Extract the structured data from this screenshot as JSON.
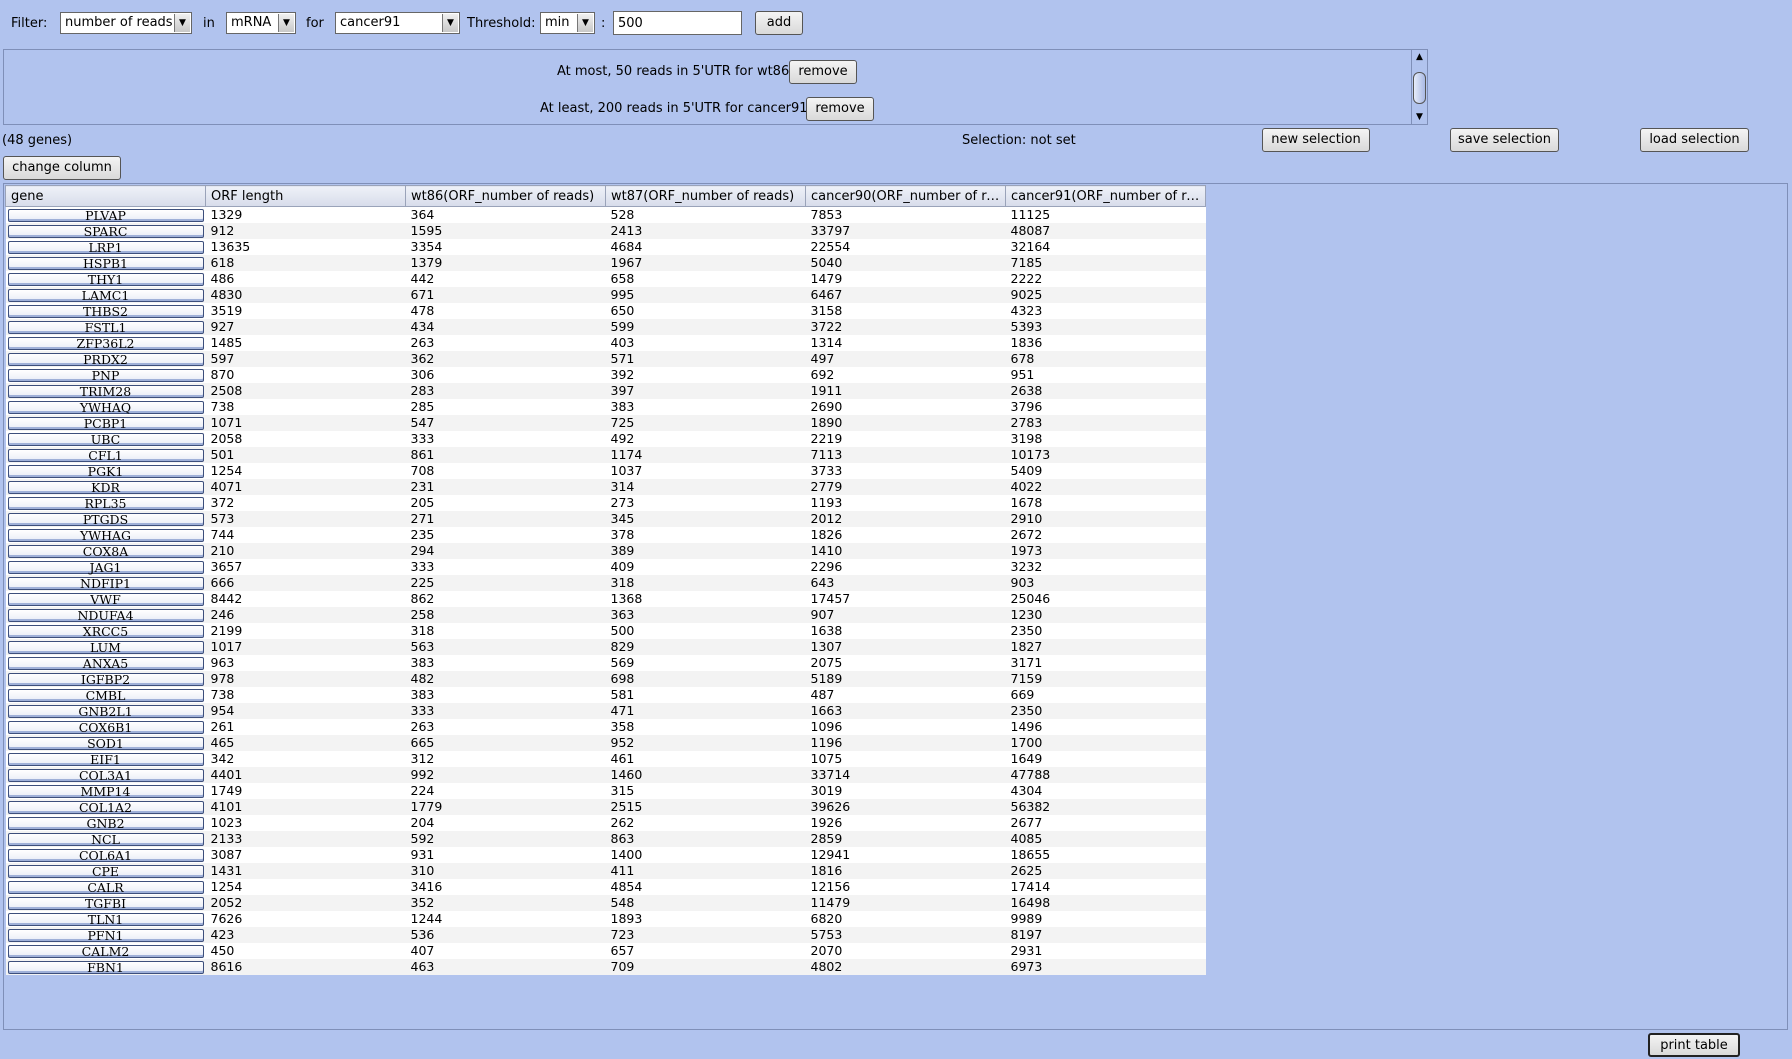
{
  "filter_bar": {
    "filter_label": "Filter:",
    "metric": "number of reads",
    "in_label": "in",
    "region": "mRNA",
    "for_label": "for",
    "sample": "cancer91",
    "threshold_label": "Threshold:",
    "threshold_mode": "min",
    "colon": ":",
    "threshold_value": "500",
    "add_label": "add"
  },
  "active_filters": [
    {
      "text": "At most, 50 reads in 5'UTR for wt86",
      "remove_label": "remove"
    },
    {
      "text": "At least, 200 reads in 5'UTR for cancer91",
      "remove_label": "remove"
    }
  ],
  "status": {
    "gene_count": "(48 genes)",
    "selection": "Selection: not set",
    "new_selection": "new selection",
    "save_selection": "save selection",
    "load_selection": "load selection",
    "change_column": "change column",
    "print_table": "print table"
  },
  "table": {
    "columns": [
      "gene",
      "ORF length",
      "wt86(ORF_number of reads)",
      "wt87(ORF_number of reads)",
      "cancer90(ORF_number of re...",
      "cancer91(ORF_number of re..."
    ],
    "rows": [
      [
        "PLVAP",
        "1329",
        "364",
        "528",
        "7853",
        "11125"
      ],
      [
        "SPARC",
        "912",
        "1595",
        "2413",
        "33797",
        "48087"
      ],
      [
        "LRP1",
        "13635",
        "3354",
        "4684",
        "22554",
        "32164"
      ],
      [
        "HSPB1",
        "618",
        "1379",
        "1967",
        "5040",
        "7185"
      ],
      [
        "THY1",
        "486",
        "442",
        "658",
        "1479",
        "2222"
      ],
      [
        "LAMC1",
        "4830",
        "671",
        "995",
        "6467",
        "9025"
      ],
      [
        "THBS2",
        "3519",
        "478",
        "650",
        "3158",
        "4323"
      ],
      [
        "FSTL1",
        "927",
        "434",
        "599",
        "3722",
        "5393"
      ],
      [
        "ZFP36L2",
        "1485",
        "263",
        "403",
        "1314",
        "1836"
      ],
      [
        "PRDX2",
        "597",
        "362",
        "571",
        "497",
        "678"
      ],
      [
        "PNP",
        "870",
        "306",
        "392",
        "692",
        "951"
      ],
      [
        "TRIM28",
        "2508",
        "283",
        "397",
        "1911",
        "2638"
      ],
      [
        "YWHAQ",
        "738",
        "285",
        "383",
        "2690",
        "3796"
      ],
      [
        "PCBP1",
        "1071",
        "547",
        "725",
        "1890",
        "2783"
      ],
      [
        "UBC",
        "2058",
        "333",
        "492",
        "2219",
        "3198"
      ],
      [
        "CFL1",
        "501",
        "861",
        "1174",
        "7113",
        "10173"
      ],
      [
        "PGK1",
        "1254",
        "708",
        "1037",
        "3733",
        "5409"
      ],
      [
        "KDR",
        "4071",
        "231",
        "314",
        "2779",
        "4022"
      ],
      [
        "RPL35",
        "372",
        "205",
        "273",
        "1193",
        "1678"
      ],
      [
        "PTGDS",
        "573",
        "271",
        "345",
        "2012",
        "2910"
      ],
      [
        "YWHAG",
        "744",
        "235",
        "378",
        "1826",
        "2672"
      ],
      [
        "COX8A",
        "210",
        "294",
        "389",
        "1410",
        "1973"
      ],
      [
        "JAG1",
        "3657",
        "333",
        "409",
        "2296",
        "3232"
      ],
      [
        "NDFIP1",
        "666",
        "225",
        "318",
        "643",
        "903"
      ],
      [
        "VWF",
        "8442",
        "862",
        "1368",
        "17457",
        "25046"
      ],
      [
        "NDUFA4",
        "246",
        "258",
        "363",
        "907",
        "1230"
      ],
      [
        "XRCC5",
        "2199",
        "318",
        "500",
        "1638",
        "2350"
      ],
      [
        "LUM",
        "1017",
        "563",
        "829",
        "1307",
        "1827"
      ],
      [
        "ANXA5",
        "963",
        "383",
        "569",
        "2075",
        "3171"
      ],
      [
        "IGFBP2",
        "978",
        "482",
        "698",
        "5189",
        "7159"
      ],
      [
        "CMBL",
        "738",
        "383",
        "581",
        "487",
        "669"
      ],
      [
        "GNB2L1",
        "954",
        "333",
        "471",
        "1663",
        "2350"
      ],
      [
        "COX6B1",
        "261",
        "263",
        "358",
        "1096",
        "1496"
      ],
      [
        "SOD1",
        "465",
        "665",
        "952",
        "1196",
        "1700"
      ],
      [
        "EIF1",
        "342",
        "312",
        "461",
        "1075",
        "1649"
      ],
      [
        "COL3A1",
        "4401",
        "992",
        "1460",
        "33714",
        "47788"
      ],
      [
        "MMP14",
        "1749",
        "224",
        "315",
        "3019",
        "4304"
      ],
      [
        "COL1A2",
        "4101",
        "1779",
        "2515",
        "39626",
        "56382"
      ],
      [
        "GNB2",
        "1023",
        "204",
        "262",
        "1926",
        "2677"
      ],
      [
        "NCL",
        "2133",
        "592",
        "863",
        "2859",
        "4085"
      ],
      [
        "COL6A1",
        "3087",
        "931",
        "1400",
        "12941",
        "18655"
      ],
      [
        "CPE",
        "1431",
        "310",
        "411",
        "1816",
        "2625"
      ],
      [
        "CALR",
        "1254",
        "3416",
        "4854",
        "12156",
        "17414"
      ],
      [
        "TGFBI",
        "2052",
        "352",
        "548",
        "11479",
        "16498"
      ],
      [
        "TLN1",
        "7626",
        "1244",
        "1893",
        "6820",
        "9989"
      ],
      [
        "PFN1",
        "423",
        "536",
        "723",
        "5753",
        "8197"
      ],
      [
        "CALM2",
        "450",
        "407",
        "657",
        "2070",
        "2931"
      ],
      [
        "FBN1",
        "8616",
        "463",
        "709",
        "4802",
        "6973"
      ]
    ]
  }
}
